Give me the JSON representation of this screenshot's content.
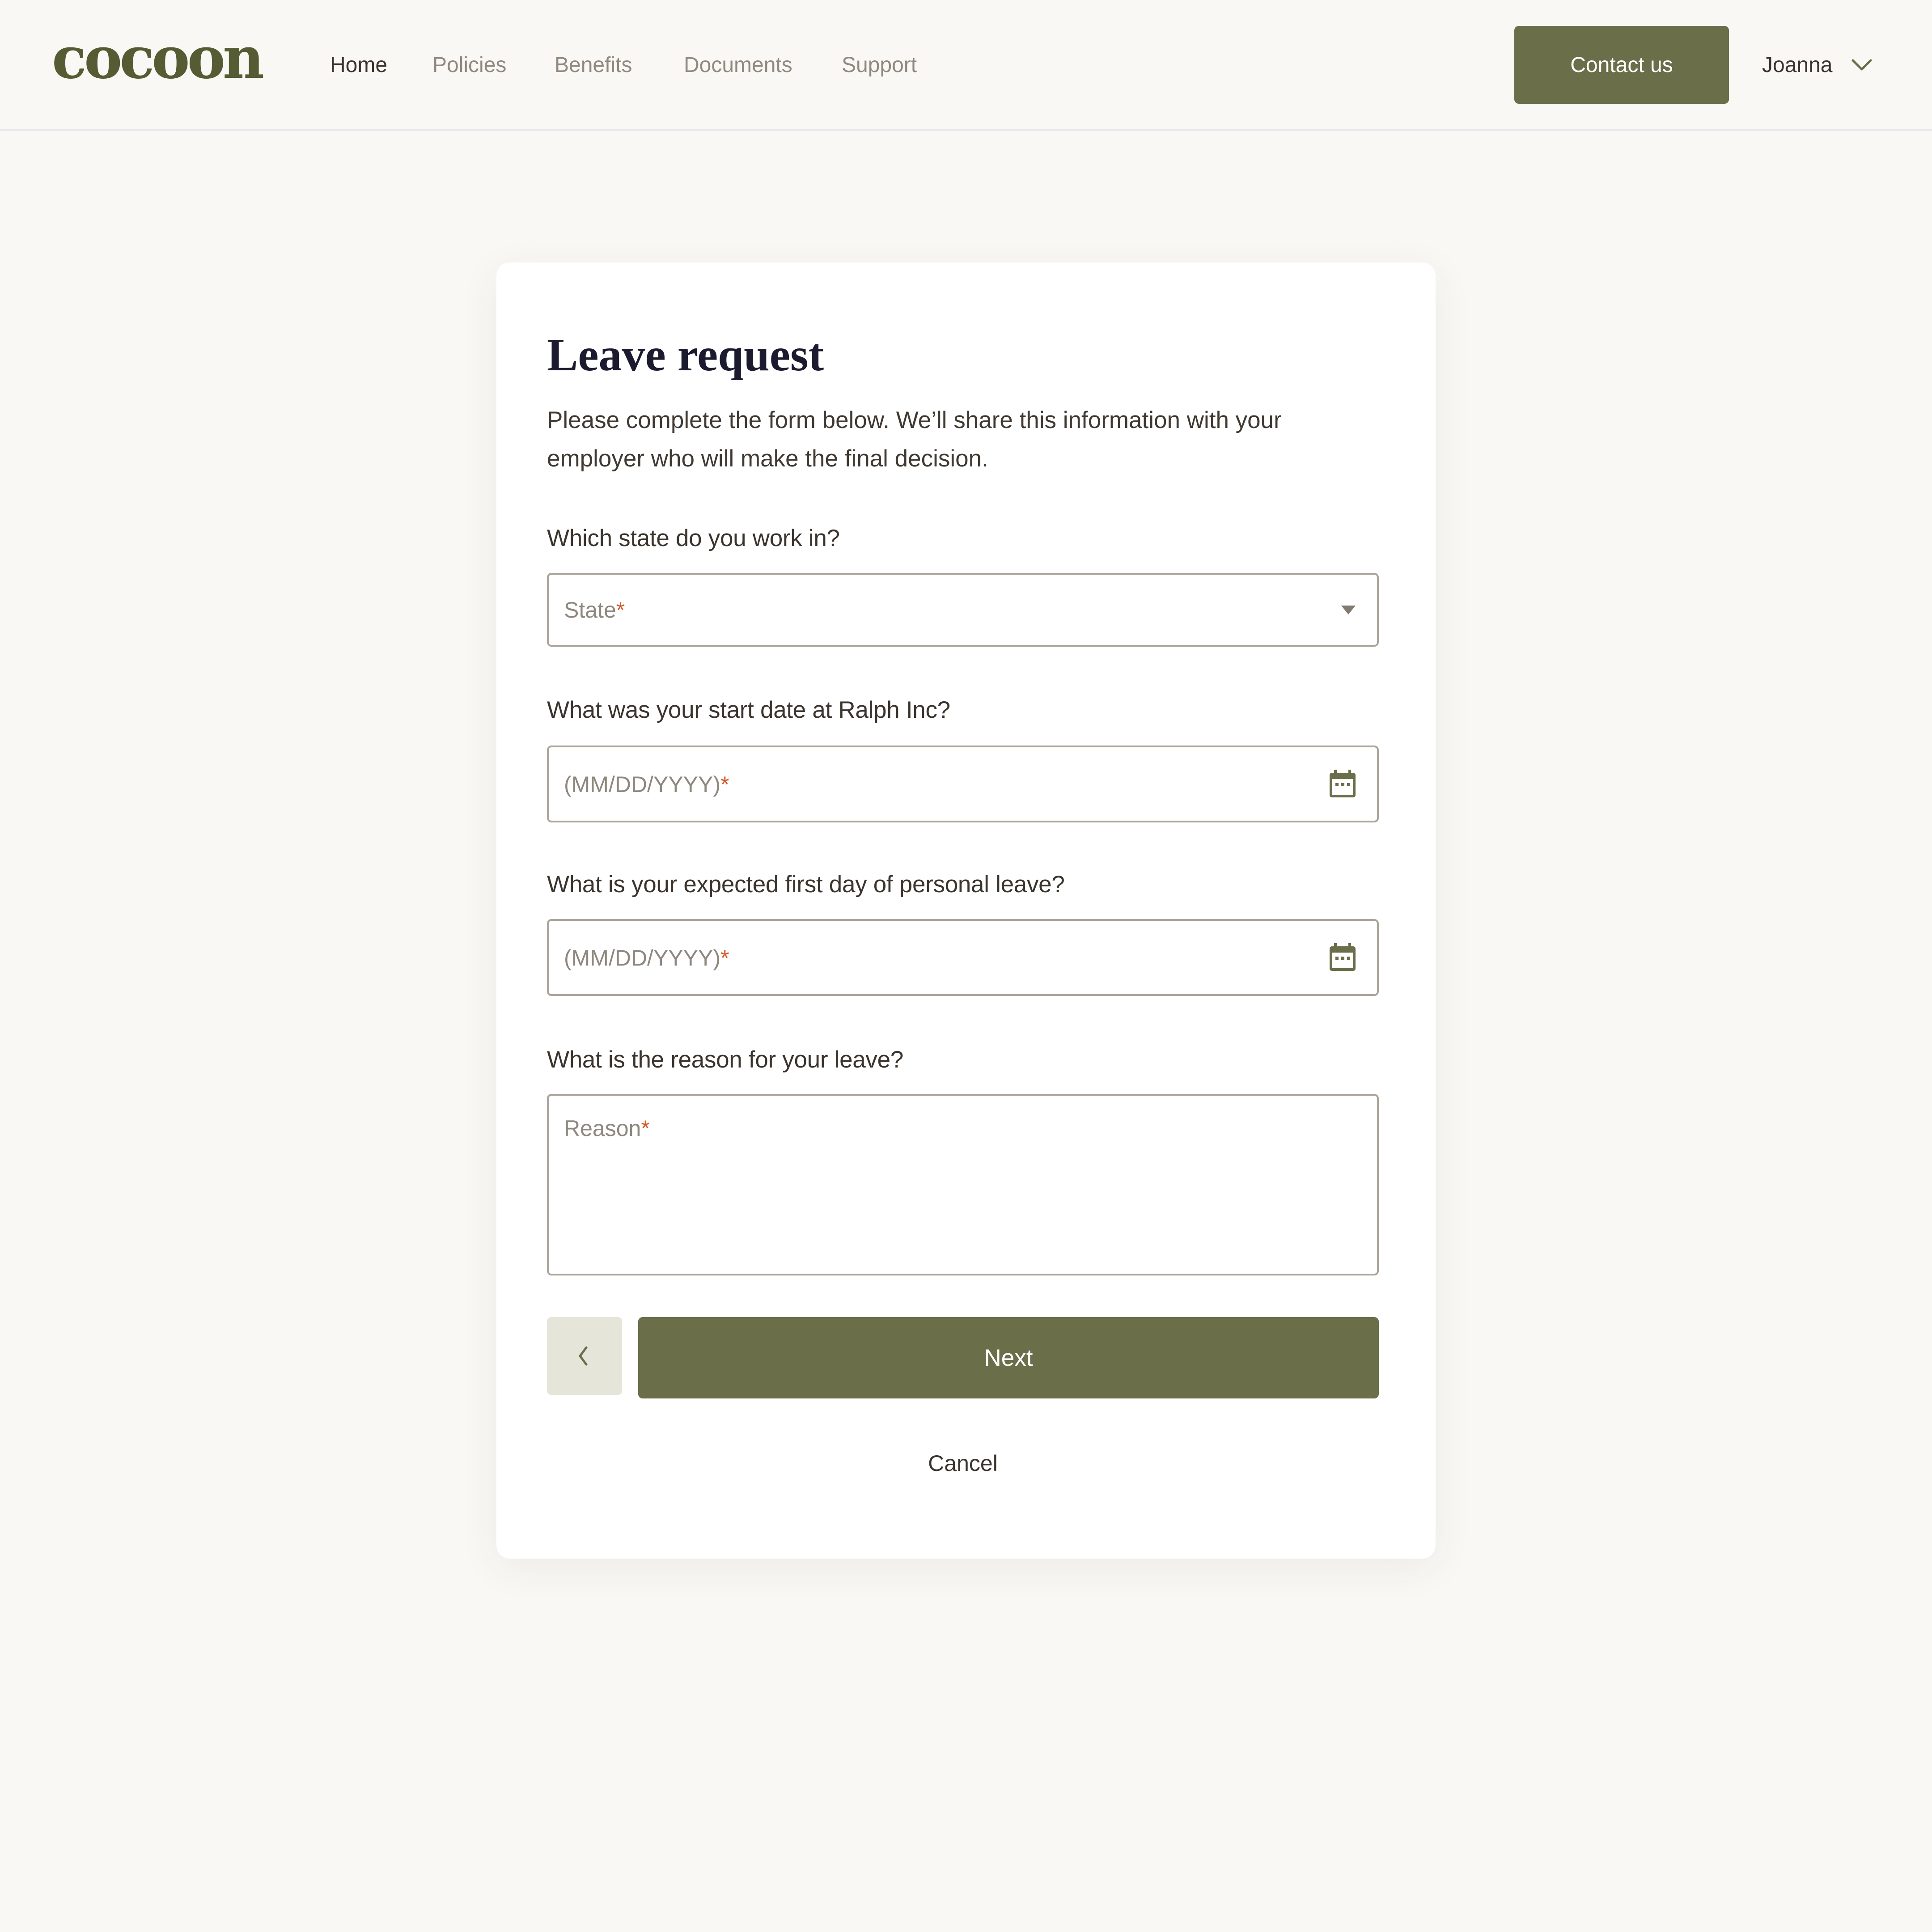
{
  "header": {
    "logo": "cocoon",
    "nav": [
      {
        "label": "Home",
        "active": true
      },
      {
        "label": "Policies",
        "active": false
      },
      {
        "label": "Benefits",
        "active": false
      },
      {
        "label": "Documents",
        "active": false
      },
      {
        "label": "Support",
        "active": false
      }
    ],
    "contact_label": "Contact us",
    "user_name": "Joanna",
    "user_menu_icon": "chevron-down-icon"
  },
  "form": {
    "title": "Leave request",
    "intro": "Please complete the form below. We’ll share this information with your employer who will make the final decision.",
    "fields": [
      {
        "label": "Which state do you work in?",
        "placeholder": "State",
        "required_mark": "*",
        "type": "select",
        "icon": "dropdown-arrow-icon"
      },
      {
        "label": "What was your start date at Ralph Inc?",
        "placeholder": "(MM/DD/YYYY)",
        "required_mark": "*",
        "type": "date",
        "icon": "calendar-icon"
      },
      {
        "label": "What is your expected first day of personal leave?",
        "placeholder": "(MM/DD/YYYY)",
        "required_mark": "*",
        "type": "date",
        "icon": "calendar-icon"
      },
      {
        "label": "What is the reason for your leave?",
        "placeholder": "Reason",
        "required_mark": "*",
        "type": "textarea"
      }
    ],
    "back_icon": "chevron-left-icon",
    "next_label": "Next",
    "cancel_label": "Cancel"
  },
  "colors": {
    "brand": "#6a6e49",
    "logo": "#555c33",
    "background": "#f9f8f5",
    "required": "#d45a28",
    "back_button_bg": "#e5e5d9"
  }
}
